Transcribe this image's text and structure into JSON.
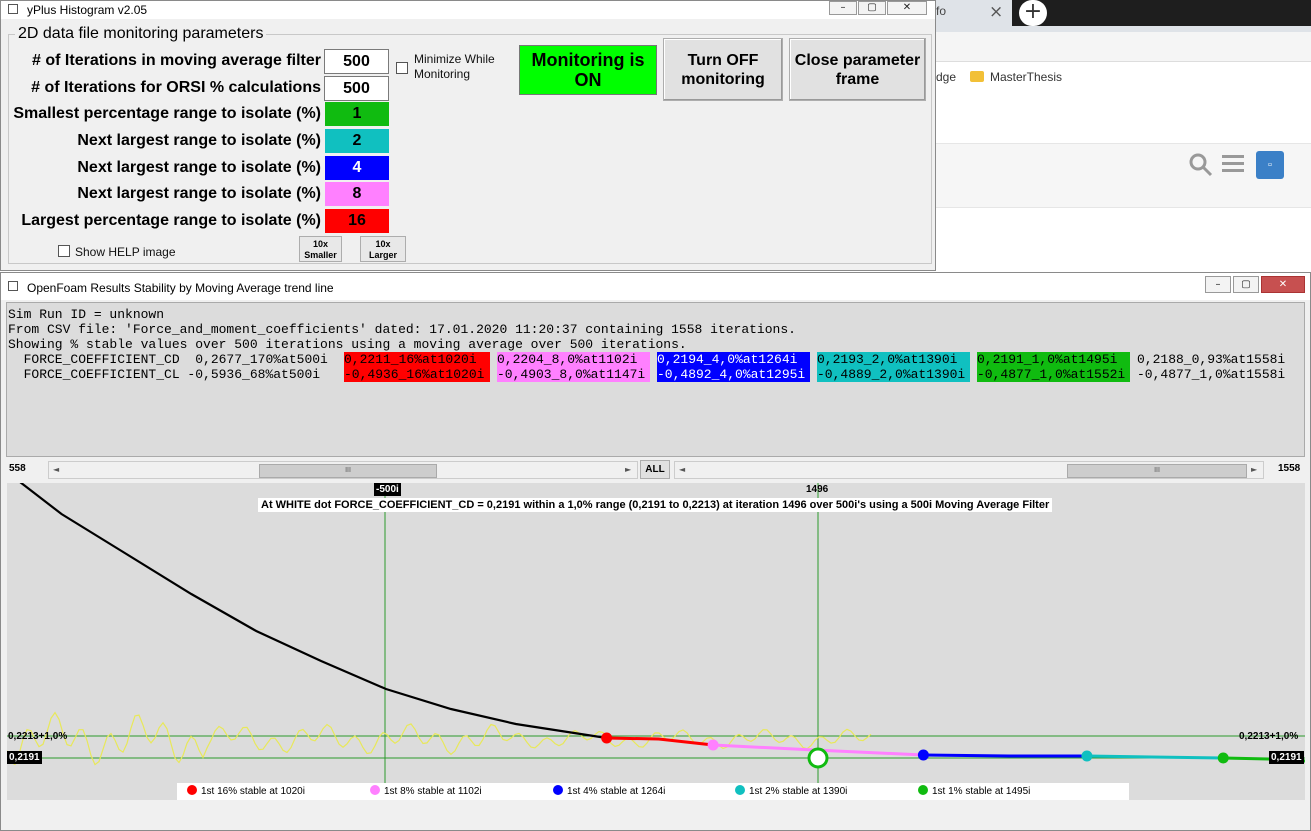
{
  "browser": {
    "tab_partial": "fo",
    "new_tab": "+",
    "close_tab": "×",
    "bookmarks": [
      {
        "label": "dge"
      },
      {
        "label": "MasterThesis"
      }
    ]
  },
  "params_window": {
    "title": "yPlus Histogram v2.05",
    "group_title": "2D data file monitoring parameters",
    "rows": [
      {
        "label": "# of Iterations in moving average filter",
        "value": "500"
      },
      {
        "label": "# of Iterations for ORSI % calculations",
        "value": "500"
      },
      {
        "label": "Smallest percentage range to isolate (%)",
        "value": "1",
        "color": "#10bb10"
      },
      {
        "label": "Next largest range to isolate (%)",
        "value": "2",
        "color": "#10c0c0"
      },
      {
        "label": "Next largest range to isolate (%)",
        "value": "4",
        "color": "#0000ff"
      },
      {
        "label": "Next largest range to isolate (%)",
        "value": "8",
        "color": "#ff80ff"
      },
      {
        "label": "Largest percentage range to isolate (%)",
        "value": "16",
        "color": "#ff0000"
      }
    ],
    "minimize_label": "Minimize While Monitoring",
    "monitoring_status": "Monitoring is ON",
    "turn_off_label": "Turn OFF monitoring",
    "close_param_label": "Close parameter frame",
    "show_help_label": "Show HELP image",
    "smaller_label": "10x Smaller",
    "larger_label": "10x Larger"
  },
  "results_window": {
    "title": "OpenFoam Results Stability by Moving Average trend line",
    "lines": [
      "Sim Run ID = unknown",
      "From CSV file: 'Force_and_moment_coefficients' dated: 17.01.2020 11:20:37 containing 1558 iterations.",
      "Showing % stable values over 500 iterations using a moving average over 500 iterations."
    ],
    "cd": {
      "label": "  FORCE_COEFFICIENT_CD  0,2677_170%at500i",
      "cells": [
        "0,2211_16%at1020i",
        "0,2204_8,0%at1102i",
        "0,2194_4,0%at1264i",
        "0,2193_2,0%at1390i",
        "0,2191_1,0%at1495i"
      ],
      "tail": "0,2188_0,93%at1558i"
    },
    "cl": {
      "label": "  FORCE_COEFFICIENT_CL -0,5936_68%at500i",
      "cells": [
        "-0,4936_16%at1020i",
        "-0,4903_8,0%at1147i",
        "-0,4892_4,0%at1295i",
        "-0,4889_2,0%at1390i",
        "-0,4877_1,0%at1552i"
      ],
      "tail": "-0,4877_1,0%at1558i"
    },
    "cell_colors": [
      "#ff0000",
      "#ff80ff",
      "#0000ff",
      "#10c0c0",
      "#10bb10"
    ],
    "cell_text_colors": [
      "#000000",
      "#000000",
      "#ffffff",
      "#000000",
      "#000000"
    ],
    "scroll_left_value": "558",
    "scroll_right_value": "1558",
    "all_button": "ALL",
    "scroll_thumb": "III"
  },
  "chart": {
    "marker_left": "-500i",
    "marker_right": "1496",
    "annotation": "At WHITE dot FORCE_COEFFICIENT_CD = 0,2191 within a 1,0% range (0,2191 to 0,2213) at iteration 1496 over 500i's using a 500i Moving Average Filter",
    "band_label": "0,2213+1,0%",
    "value_label": "0,2191",
    "legend": [
      {
        "label": "1st 16% stable at 1020i",
        "color": "#ff0000"
      },
      {
        "label": "1st 8% stable at 1102i",
        "color": "#ff80ff"
      },
      {
        "label": "1st 4% stable at 1264i",
        "color": "#0000ff"
      },
      {
        "label": "1st 2% stable at 1390i",
        "color": "#10c0c0"
      },
      {
        "label": "1st 1% stable at 1495i",
        "color": "#10bb10"
      }
    ]
  },
  "chart_data": {
    "type": "line",
    "title": "",
    "xlabel": "",
    "ylabel": "",
    "xlim": [
      558,
      1558
    ],
    "y_reference": {
      "value": 0.2191,
      "upper": 0.2213
    },
    "series": [
      {
        "name": "moving average",
        "x": [
          558,
          600,
          650,
          700,
          750,
          800,
          850,
          900,
          950,
          1000,
          1020
        ],
        "y": [
          0.2477,
          0.2435,
          0.2395,
          0.2355,
          0.2318,
          0.2288,
          0.226,
          0.224,
          0.2225,
          0.2215,
          0.2211
        ]
      },
      {
        "name": "16%",
        "x": [
          1020,
          1060,
          1102
        ],
        "y": [
          0.2211,
          0.221,
          0.2204
        ]
      },
      {
        "name": "8%",
        "x": [
          1102,
          1180,
          1264
        ],
        "y": [
          0.2204,
          0.2199,
          0.2194
        ]
      },
      {
        "name": "4%",
        "x": [
          1264,
          1330,
          1390
        ],
        "y": [
          0.2194,
          0.2193,
          0.2193
        ]
      },
      {
        "name": "2%",
        "x": [
          1390,
          1440,
          1495
        ],
        "y": [
          0.2193,
          0.2192,
          0.2191
        ]
      },
      {
        "name": "1%",
        "x": [
          1495,
          1530,
          1558
        ],
        "y": [
          0.2191,
          0.219,
          0.2188
        ]
      }
    ],
    "stable_points": [
      {
        "x": 1020,
        "y": 0.2211
      },
      {
        "x": 1102,
        "y": 0.2204
      },
      {
        "x": 1264,
        "y": 0.2194
      },
      {
        "x": 1390,
        "y": 0.2193
      },
      {
        "x": 1495,
        "y": 0.2191
      }
    ]
  }
}
